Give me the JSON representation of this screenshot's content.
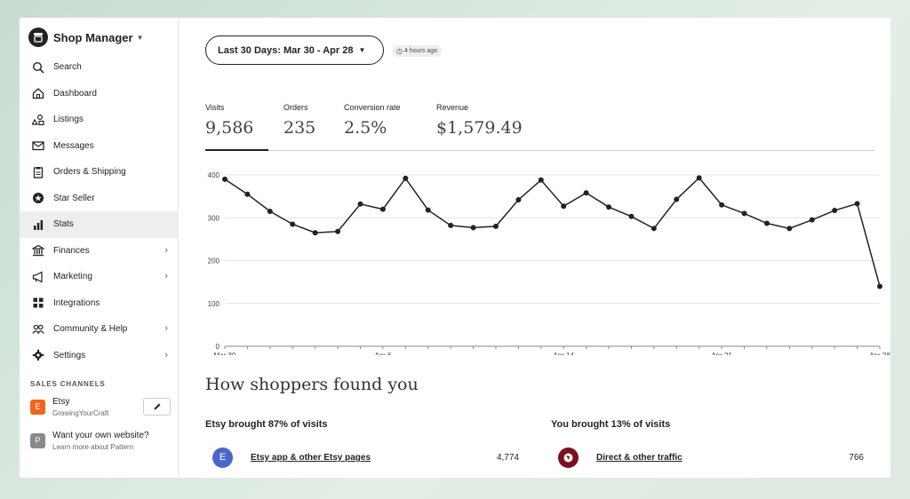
{
  "sidebar": {
    "title": "Shop Manager",
    "items": [
      {
        "label": "Search",
        "icon": "search-icon"
      },
      {
        "label": "Dashboard",
        "icon": "home-icon"
      },
      {
        "label": "Listings",
        "icon": "listings-icon"
      },
      {
        "label": "Messages",
        "icon": "mail-icon"
      },
      {
        "label": "Orders & Shipping",
        "icon": "clipboard-icon"
      },
      {
        "label": "Star Seller",
        "icon": "star-badge-icon"
      },
      {
        "label": "Stats",
        "icon": "bar-chart-icon",
        "active": true
      },
      {
        "label": "Finances",
        "icon": "bank-icon",
        "has_submenu": true
      },
      {
        "label": "Marketing",
        "icon": "megaphone-icon",
        "has_submenu": true
      },
      {
        "label": "Integrations",
        "icon": "grid-icon"
      },
      {
        "label": "Community & Help",
        "icon": "people-icon",
        "has_submenu": true
      },
      {
        "label": "Settings",
        "icon": "gear-icon",
        "has_submenu": true
      }
    ],
    "sales_channels_label": "SALES CHANNELS",
    "channel": {
      "badge": "E",
      "name": "Etsy",
      "shop": "GrowingYourCraft",
      "badge_color": "#f1641e"
    },
    "website": {
      "badge": "P",
      "title": "Want your own website?",
      "subtitle": "Learn more about Pattern"
    }
  },
  "toolbar": {
    "date_range": "Last 30 Days: Mar 30 - Apr 28",
    "updated": "4 hours ago"
  },
  "metrics": [
    {
      "label": "Visits",
      "value": "9,586"
    },
    {
      "label": "Orders",
      "value": "235"
    },
    {
      "label": "Conversion rate",
      "value": "2.5%"
    },
    {
      "label": "Revenue",
      "value": "$1,579.49"
    }
  ],
  "chart_data": {
    "type": "line",
    "x": [
      "Mar 30",
      "Mar 31",
      "Apr 1",
      "Apr 2",
      "Apr 3",
      "Apr 4",
      "Apr 5",
      "Apr 6",
      "Apr 7",
      "Apr 8",
      "Apr 9",
      "Apr 10",
      "Apr 11",
      "Apr 12",
      "Apr 13",
      "Apr 14",
      "Apr 15",
      "Apr 16",
      "Apr 17",
      "Apr 18",
      "Apr 19",
      "Apr 20",
      "Apr 21",
      "Apr 22",
      "Apr 23",
      "Apr 24",
      "Apr 25",
      "Apr 26",
      "Apr 27",
      "Apr 28"
    ],
    "series": [
      {
        "values": [
          390,
          355,
          315,
          285,
          265,
          268,
          332,
          320,
          392,
          318,
          282,
          277,
          280,
          342,
          388,
          327,
          358,
          325,
          303,
          275,
          343,
          393,
          330,
          310,
          287,
          275,
          295,
          317,
          333,
          140
        ]
      }
    ],
    "x_tick_labels": [
      "Mar 30",
      "Apr 6",
      "Apr 14",
      "Apr 21",
      "Apr 28"
    ],
    "y_ticks": [
      0,
      100,
      200,
      300,
      400
    ],
    "ylim": [
      0,
      400
    ],
    "grid": true,
    "line_color": "#222222"
  },
  "found": {
    "title": "How shoppers found you",
    "etsy_heading": "Etsy brought 87% of visits",
    "you_heading": "You brought 13% of visits",
    "etsy_source": {
      "label": "Etsy app & other Etsy pages",
      "count": "4,774",
      "badge": "E",
      "color": "#4a67c8"
    },
    "you_source": {
      "label": "Direct & other traffic",
      "count": "766",
      "color": "#7a1020"
    }
  }
}
